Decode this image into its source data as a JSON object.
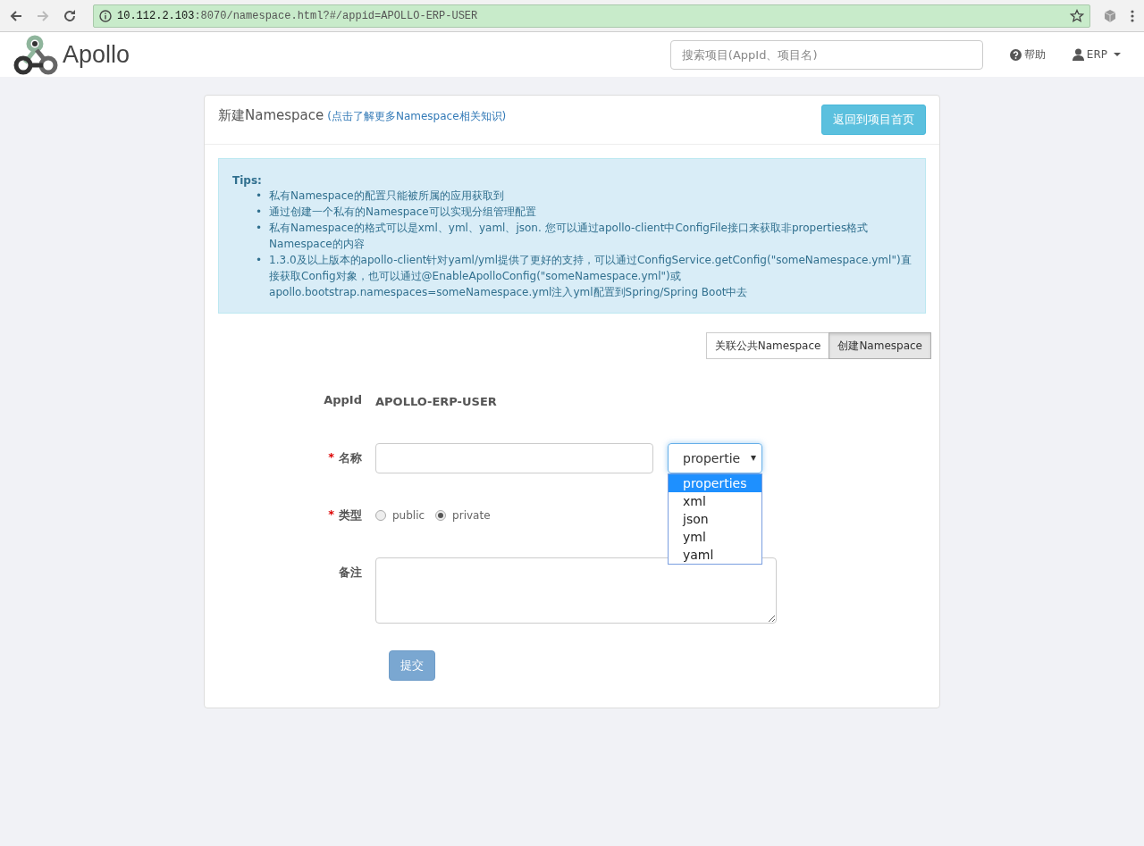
{
  "browser": {
    "url_host": "10.112.2.103",
    "url_path": ":8070/namespace.html?#/appid=APOLLO-ERP-USER"
  },
  "navbar": {
    "logo_text": "Apollo",
    "search": {
      "placeholder": "搜索项目(AppId、项目名)"
    },
    "help": "帮助",
    "user": "ERP"
  },
  "panel": {
    "title": "新建Namespace",
    "title_link": "(点击了解更多Namespace相关知识)",
    "back_button": "返回到项目首页"
  },
  "tips": {
    "heading": "Tips:",
    "bullet": "•",
    "items": [
      "私有Namespace的配置只能被所属的应用获取到",
      "通过创建一个私有的Namespace可以实现分组管理配置",
      "私有Namespace的格式可以是xml、yml、yaml、json. 您可以通过apollo-client中ConfigFile接口来获取非properties格式Namespace的内容",
      "1.3.0及以上版本的apollo-client针对yaml/yml提供了更好的支持，可以通过ConfigService.getConfig(\"someNamespace.yml\")直接获取Config对象，也可以通过@EnableApolloConfig(\"someNamespace.yml\")或apollo.bootstrap.namespaces=someNamespace.yml注入yml配置到Spring/Spring Boot中去"
    ]
  },
  "mode_tabs": [
    {
      "label": "关联公共Namespace",
      "selected": false
    },
    {
      "label": "创建Namespace",
      "selected": true
    }
  ],
  "form": {
    "appid": {
      "label": "AppId",
      "value": "APOLLO-ERP-USER"
    },
    "name": {
      "label": "名称",
      "required_mark": "*",
      "format": {
        "value": "propertie",
        "expanded": true,
        "options": [
          {
            "label": "properties",
            "selected": true
          },
          {
            "label": "xml",
            "selected": false
          },
          {
            "label": "json",
            "selected": false
          },
          {
            "label": "yml",
            "selected": false
          },
          {
            "label": "yaml",
            "selected": false
          }
        ]
      }
    },
    "type": {
      "label": "类型",
      "required_mark": "*",
      "options": [
        {
          "label": "public",
          "selected": false
        },
        {
          "label": "private",
          "selected": true
        }
      ]
    },
    "comment": {
      "label": "备注"
    },
    "submit": "提交"
  }
}
